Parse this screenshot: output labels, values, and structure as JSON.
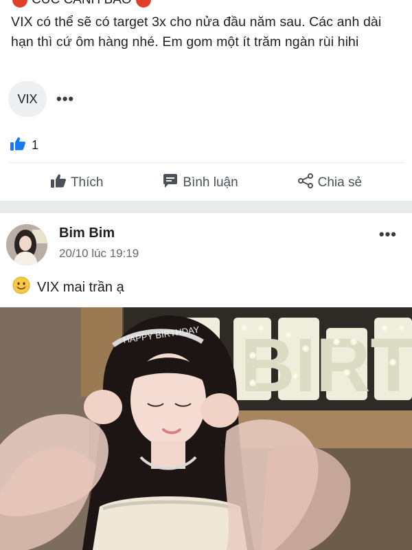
{
  "post1": {
    "header_cut": "CÚC CẢNH BÁO",
    "text": "VIX có thể sẽ có target 3x cho nửa đầu năm sau. Các anh dài hạn thì cứ ôm hàng nhé. Em gom một ít trăm ngàn rùi hihi",
    "tag": "VIX",
    "more": "•••",
    "reaction_count": "1",
    "actions": {
      "like": "Thích",
      "comment": "Bình luận",
      "share": "Chia sẻ"
    }
  },
  "post2": {
    "author": "Bim Bim",
    "time": "20/10 lúc 19:19",
    "more": "•••",
    "text": "VIX mai trần ạ",
    "photo": {
      "sign_text": "BIRTH",
      "tiara_text": "HAPPY BIRTHDAY"
    }
  },
  "colors": {
    "accent_blue": "#1877f2",
    "separator": "#e9eaec",
    "text_secondary": "#65676b",
    "red_emoji": "#e0402b",
    "smile_emoji": "#f7c944"
  },
  "icons": [
    "red-circle-icon",
    "thumbs-up-reaction-icon",
    "like-icon",
    "comment-icon",
    "share-icon",
    "more-icon",
    "smile-emoji-icon"
  ]
}
